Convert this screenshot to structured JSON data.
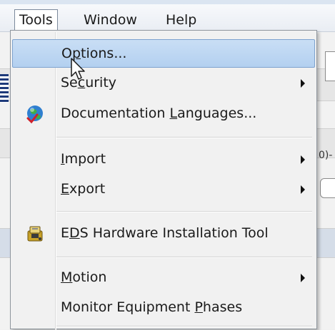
{
  "menubar": {
    "items": [
      {
        "label": "Tools"
      },
      {
        "label": "Window"
      },
      {
        "label": "Help"
      }
    ]
  },
  "background": {
    "fragment_text_1": "0)-"
  },
  "tools_menu": {
    "items": [
      {
        "label": "Options...",
        "mnemonic": "p",
        "highlighted": true
      },
      {
        "label": "Security",
        "mnemonic": "c",
        "has_submenu": true
      },
      {
        "label": "Documentation Languages...",
        "mnemonic": "L",
        "icon": "globe-icon"
      },
      {
        "label": "Import",
        "mnemonic": "I",
        "has_submenu": true
      },
      {
        "label": "Export",
        "mnemonic": "E",
        "has_submenu": true
      },
      {
        "label": "EDS Hardware Installation Tool",
        "mnemonic": "D",
        "icon": "hardware-install-icon"
      },
      {
        "label": "Motion",
        "mnemonic": "M",
        "has_submenu": true
      },
      {
        "label": "Monitor Equipment Phases",
        "mnemonic": "P"
      }
    ]
  },
  "colors": {
    "highlight_bg": "#c4daf3",
    "highlight_border": "#7da2ce",
    "menu_bg": "#f1f1f1"
  }
}
